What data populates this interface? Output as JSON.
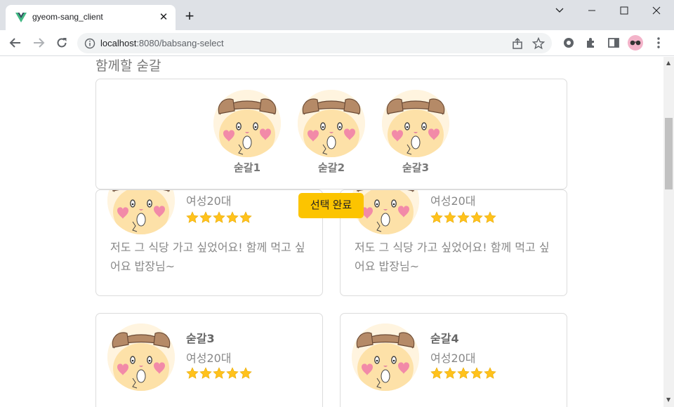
{
  "browser": {
    "tab_title": "gyeom-sang_client",
    "url_host": "localhost",
    "url_path": ":8080/babsang-select",
    "colors": {
      "tab_bar": "#dee1e6",
      "accent_vue": "#41b883"
    }
  },
  "page": {
    "section_title": "함께할 숟갈",
    "companions": [
      {
        "name": "숟갈1"
      },
      {
        "name": "숟갈2"
      },
      {
        "name": "숟갈3"
      }
    ],
    "done_button": "선택 완료",
    "reviews": [
      {
        "name": "",
        "sub": "여성20대",
        "rating": 5,
        "text": "저도 그 식당 가고 싶었어요! 함께 먹고 싶어요 밥장님~"
      },
      {
        "name": "",
        "sub": "여성20대",
        "rating": 5,
        "text": "저도 그 식당 가고 싶었어요! 함께 먹고 싶어요 밥장님~"
      },
      {
        "name": "숟갈3",
        "sub": "여성20대",
        "rating": 5,
        "text": ""
      },
      {
        "name": "숟갈4",
        "sub": "여성20대",
        "rating": 5,
        "text": ""
      }
    ],
    "colors": {
      "button": "#fcc400",
      "star": "#ffc21c"
    }
  }
}
